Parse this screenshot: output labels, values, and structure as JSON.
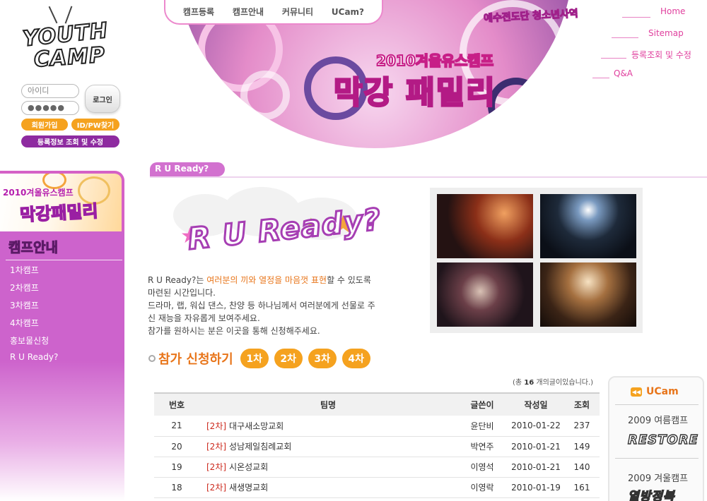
{
  "logo": {
    "line1": "YOUTH",
    "line2": "CAMP"
  },
  "login": {
    "id_placeholder": "아이디",
    "pw_mask": "●●●●●",
    "login_label": "로그인",
    "join_label": "회원가입",
    "find_label": "ID/PW찾기",
    "lookup_label": "등록정보 조회 및 수정"
  },
  "top_nav": [
    "캠프등록",
    "캠프안내",
    "커뮤니티",
    "UCam?"
  ],
  "util_links": [
    "Home",
    "Sitemap",
    "등록조회 및 수정",
    "Q&A"
  ],
  "hero": {
    "sub": "예수전도단 청소년사역",
    "year": "2010겨울유스캠프",
    "title": "막강 패밀리"
  },
  "side_banner": {
    "year": "2010겨울유스캠프",
    "title": "막강패밀리"
  },
  "side_nav": {
    "title": "캠프안내",
    "items": [
      "1차캠프",
      "2차캠프",
      "3차캠프",
      "4차캠프",
      "홍보물신청",
      "R U Ready?"
    ]
  },
  "section_tab": "R U Ready?",
  "rur_logo": "R U Ready?",
  "intro": {
    "p1_a": "R U Ready?는 ",
    "p1_hl": "여러분의 끼와 열정을 마음껏 표현",
    "p1_b": "할 수 있도록 마련된 시간입니다.",
    "p2": "드라마, 랩, 워십 댄스, 찬양 등 하나님께서 여러분에게 선물로 주신 재능을 자유롭게 보여주세요.",
    "p3": "참가를 원하시는 분은 이곳을 통해 신청해주세요."
  },
  "apply": {
    "title": "참가 신청하기",
    "rounds": [
      "1차",
      "2차",
      "3차",
      "4차"
    ]
  },
  "count_note": {
    "prefix": "(총 ",
    "count": "16",
    "suffix": " 개의글이있습니다.)"
  },
  "board": {
    "headers": [
      "번호",
      "팀명",
      "글쓴이",
      "작성일",
      "조회"
    ],
    "rows": [
      {
        "no": "21",
        "tag": "[2차]",
        "team": "대구새소망교회",
        "writer": "윤단비",
        "date": "2010-01-22",
        "views": "237"
      },
      {
        "no": "20",
        "tag": "[2차]",
        "team": "성남제일침례교회",
        "writer": "박연주",
        "date": "2010-01-21",
        "views": "149"
      },
      {
        "no": "19",
        "tag": "[2차]",
        "team": "시온성교회",
        "writer": "이영석",
        "date": "2010-01-21",
        "views": "140"
      },
      {
        "no": "18",
        "tag": "[2차]",
        "team": "새생명교회",
        "writer": "이영락",
        "date": "2010-01-19",
        "views": "161"
      }
    ]
  },
  "ucam": {
    "title": "UCam",
    "entries": [
      {
        "label": "2009 여름캠프",
        "logo": "RESTORE"
      },
      {
        "label": "2009 겨울캠프",
        "logo": "열방정복"
      }
    ]
  },
  "colors": {
    "accent_orange": "#f5a21f",
    "accent_purple": "#cd63cc",
    "link_pink": "#e0409e",
    "tag_red": "#cc2a1e"
  },
  "icons": [
    "star-icon",
    "speaker-icon",
    "radio-bullet-icon"
  ]
}
